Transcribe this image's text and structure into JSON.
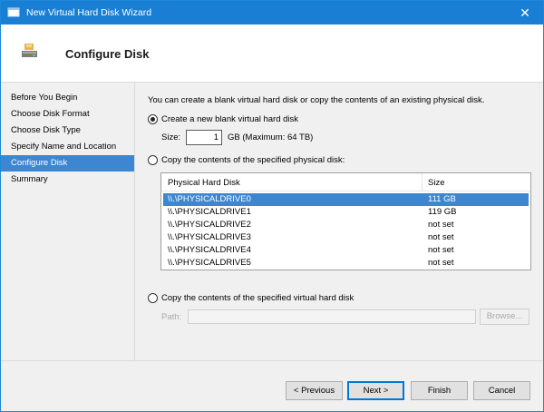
{
  "window": {
    "title": "New Virtual Hard Disk Wizard",
    "close_glyph": "✕"
  },
  "header": {
    "title": "Configure Disk",
    "icon": "disk-wizard-icon"
  },
  "sidebar": {
    "items": [
      {
        "label": "Before You Begin",
        "active": false
      },
      {
        "label": "Choose Disk Format",
        "active": false
      },
      {
        "label": "Choose Disk Type",
        "active": false
      },
      {
        "label": "Specify Name and Location",
        "active": false
      },
      {
        "label": "Configure Disk",
        "active": true
      },
      {
        "label": "Summary",
        "active": false
      }
    ]
  },
  "main": {
    "intro": "You can create a blank virtual hard disk or copy the contents of an existing physical disk.",
    "option_blank": {
      "label": "Create a new blank virtual hard disk",
      "checked": true
    },
    "size": {
      "label": "Size:",
      "value": "1",
      "unit": "GB (Maximum: 64 TB)"
    },
    "option_physical": {
      "label": "Copy the contents of the specified physical disk:",
      "checked": false
    },
    "physical_table": {
      "columns": [
        "Physical Hard Disk",
        "Size"
      ],
      "rows": [
        {
          "disk": "\\\\.\\PHYSICALDRIVE0",
          "size": "111 GB",
          "selected": true
        },
        {
          "disk": "\\\\.\\PHYSICALDRIVE1",
          "size": "119 GB",
          "selected": false
        },
        {
          "disk": "\\\\.\\PHYSICALDRIVE2",
          "size": "not set",
          "selected": false
        },
        {
          "disk": "\\\\.\\PHYSICALDRIVE3",
          "size": "not set",
          "selected": false
        },
        {
          "disk": "\\\\.\\PHYSICALDRIVE4",
          "size": "not set",
          "selected": false
        },
        {
          "disk": "\\\\.\\PHYSICALDRIVE5",
          "size": "not set",
          "selected": false
        }
      ]
    },
    "option_virtual": {
      "label": "Copy the contents of the specified virtual hard disk",
      "checked": false
    },
    "path": {
      "label": "Path:",
      "value": ""
    },
    "browse_label": "Browse..."
  },
  "footer": {
    "previous": "< Previous",
    "next": "Next >",
    "finish": "Finish",
    "cancel": "Cancel"
  },
  "colors": {
    "titlebar": "#1a7fd4",
    "selection": "#3d86d1"
  }
}
